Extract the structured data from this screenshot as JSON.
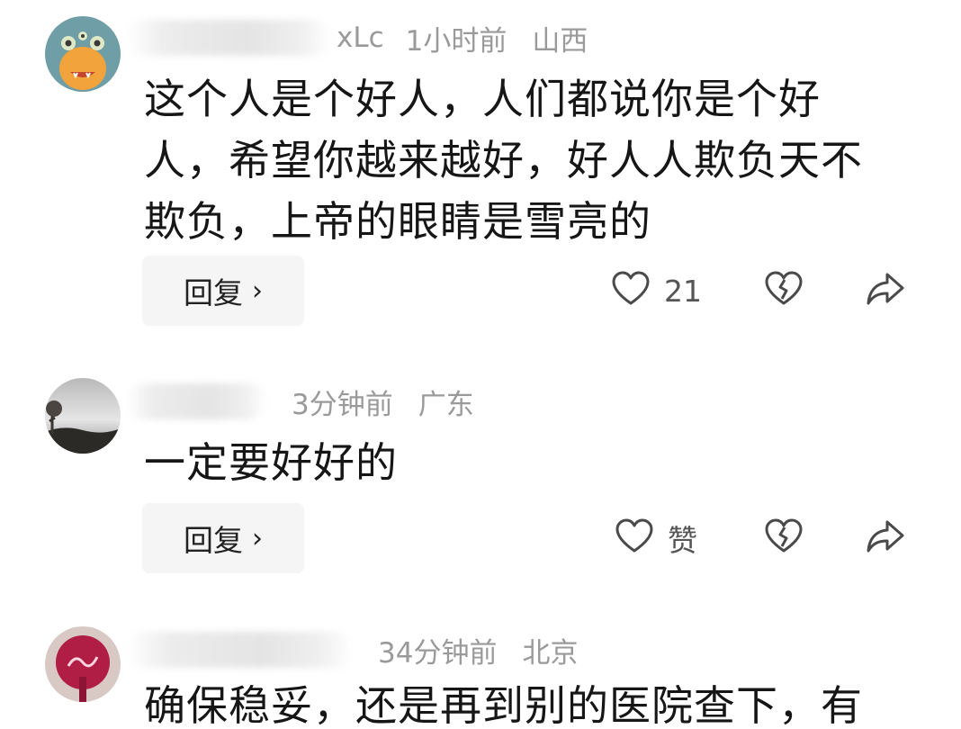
{
  "comments": [
    {
      "name_tail": "xLc",
      "time": "1小时前",
      "location": "山西",
      "text": "这个人是个好人，人们都说你是个好人，希望你越来越好，好人人欺负天不欺负，上帝的眼睛是雪亮的",
      "reply_label": "回复",
      "reply_chevron": "›",
      "like_label": "21"
    },
    {
      "name_tail": "",
      "time": "3分钟前",
      "location": "广东",
      "text": "一定要好好的",
      "reply_label": "回复",
      "reply_chevron": "›",
      "like_label": "赞"
    },
    {
      "name_tail": "",
      "time": "34分钟前",
      "location": "北京",
      "text": "确保稳妥，还是再到别的医院查下，有"
    }
  ],
  "icons": {
    "like": "heart-outline-icon",
    "dislike": "broken-heart-icon",
    "share": "share-arrow-icon"
  },
  "colors": {
    "meta": "#9a9a9a",
    "text": "#161616",
    "reply_bg": "#f5f5f5",
    "icon": "#4a4a4a"
  }
}
